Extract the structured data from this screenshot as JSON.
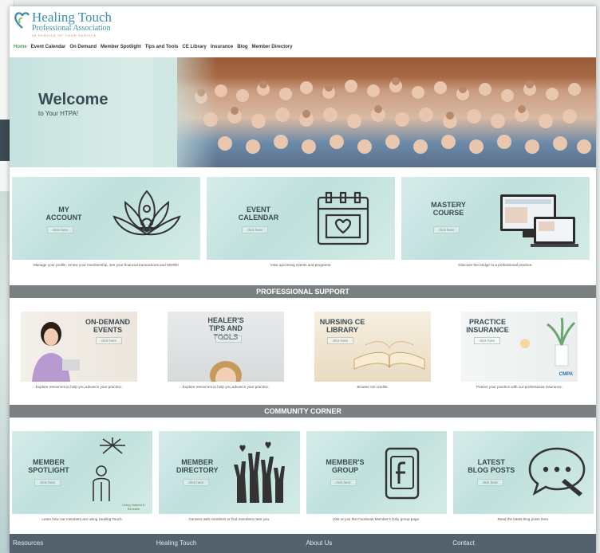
{
  "logo": {
    "title": "Healing Touch",
    "subtitle": "Professional Association",
    "tagline": "IN SERVICE OF YOUR SERVICE"
  },
  "nav": [
    "Home",
    "Event Calendar",
    "On Demand",
    "Member Spotlight",
    "Tips and Tools",
    "CE Library",
    "Insurance",
    "Blog",
    "Member Directory"
  ],
  "hero": {
    "title": "Welcome",
    "subtitle": "to Your HTPA!"
  },
  "top_tiles": [
    {
      "title": "MY\nACCOUNT",
      "button": "click here",
      "caption": "Manage your profile, renew your membership, see your financial transactions and MORE!",
      "icon": "lotus-meditation-icon"
    },
    {
      "title": "EVENT\nCALENDAR",
      "button": "click here",
      "caption": "View upcoming events and programs.",
      "icon": "calendar-heart-icon"
    },
    {
      "title": "MASTERY\nCOURSE",
      "button": "click here",
      "caption": "Discover the bridge to a professional practice.",
      "icon": "devices-icon"
    }
  ],
  "band_professional": "PROFESSIONAL SUPPORT",
  "support_tiles": [
    {
      "title": "ON-DEMAND\nEVENTS",
      "button": "click here",
      "caption": "Explore resources to help you advance your practice."
    },
    {
      "title": "HEALER'S\nTIPS AND TOOLS",
      "button": "click here",
      "caption": "Explore resources to help you advance your practice."
    },
    {
      "title": "NURSING CE\nLIBRARY",
      "button": "click here",
      "caption": "Browse CE credits."
    },
    {
      "title": "PRACTICE\nINSURANCE",
      "button": "click here",
      "caption": "Protect your practice with our professional insurance.",
      "badge": "CMPA"
    }
  ],
  "band_community": "COMMUNITY CORNER",
  "community_tiles": [
    {
      "title": "MEMBER\nSPOTLIGHT",
      "button": "click here",
      "caption": "Learn how our members are using Healing Touch.",
      "stamp": "Living Natural & Sensible",
      "icon": "person-sun-icon"
    },
    {
      "title": "MEMBER\nDIRECTORY",
      "button": "click here",
      "caption": "Connect with members or find members near you.",
      "icon": "raised-hands-icon"
    },
    {
      "title": "MEMBER'S\nGROUP",
      "button": "click here",
      "caption": "Visit or join the Facebook Member's Only group page.",
      "icon": "facebook-icon"
    },
    {
      "title": "LATEST\nBLOG POSTS",
      "button": "click here",
      "caption": "Read the latest blog posts here.",
      "icon": "chat-bubble-pencil-icon"
    }
  ],
  "footer": [
    "Resources",
    "Healing Touch",
    "About Us",
    "Contact"
  ],
  "colors": {
    "accent": "#4aa05c",
    "band": "#7a7f82",
    "footer": "#54626e",
    "tile": "#c6e4e0",
    "brand": "#3b8fa6"
  }
}
